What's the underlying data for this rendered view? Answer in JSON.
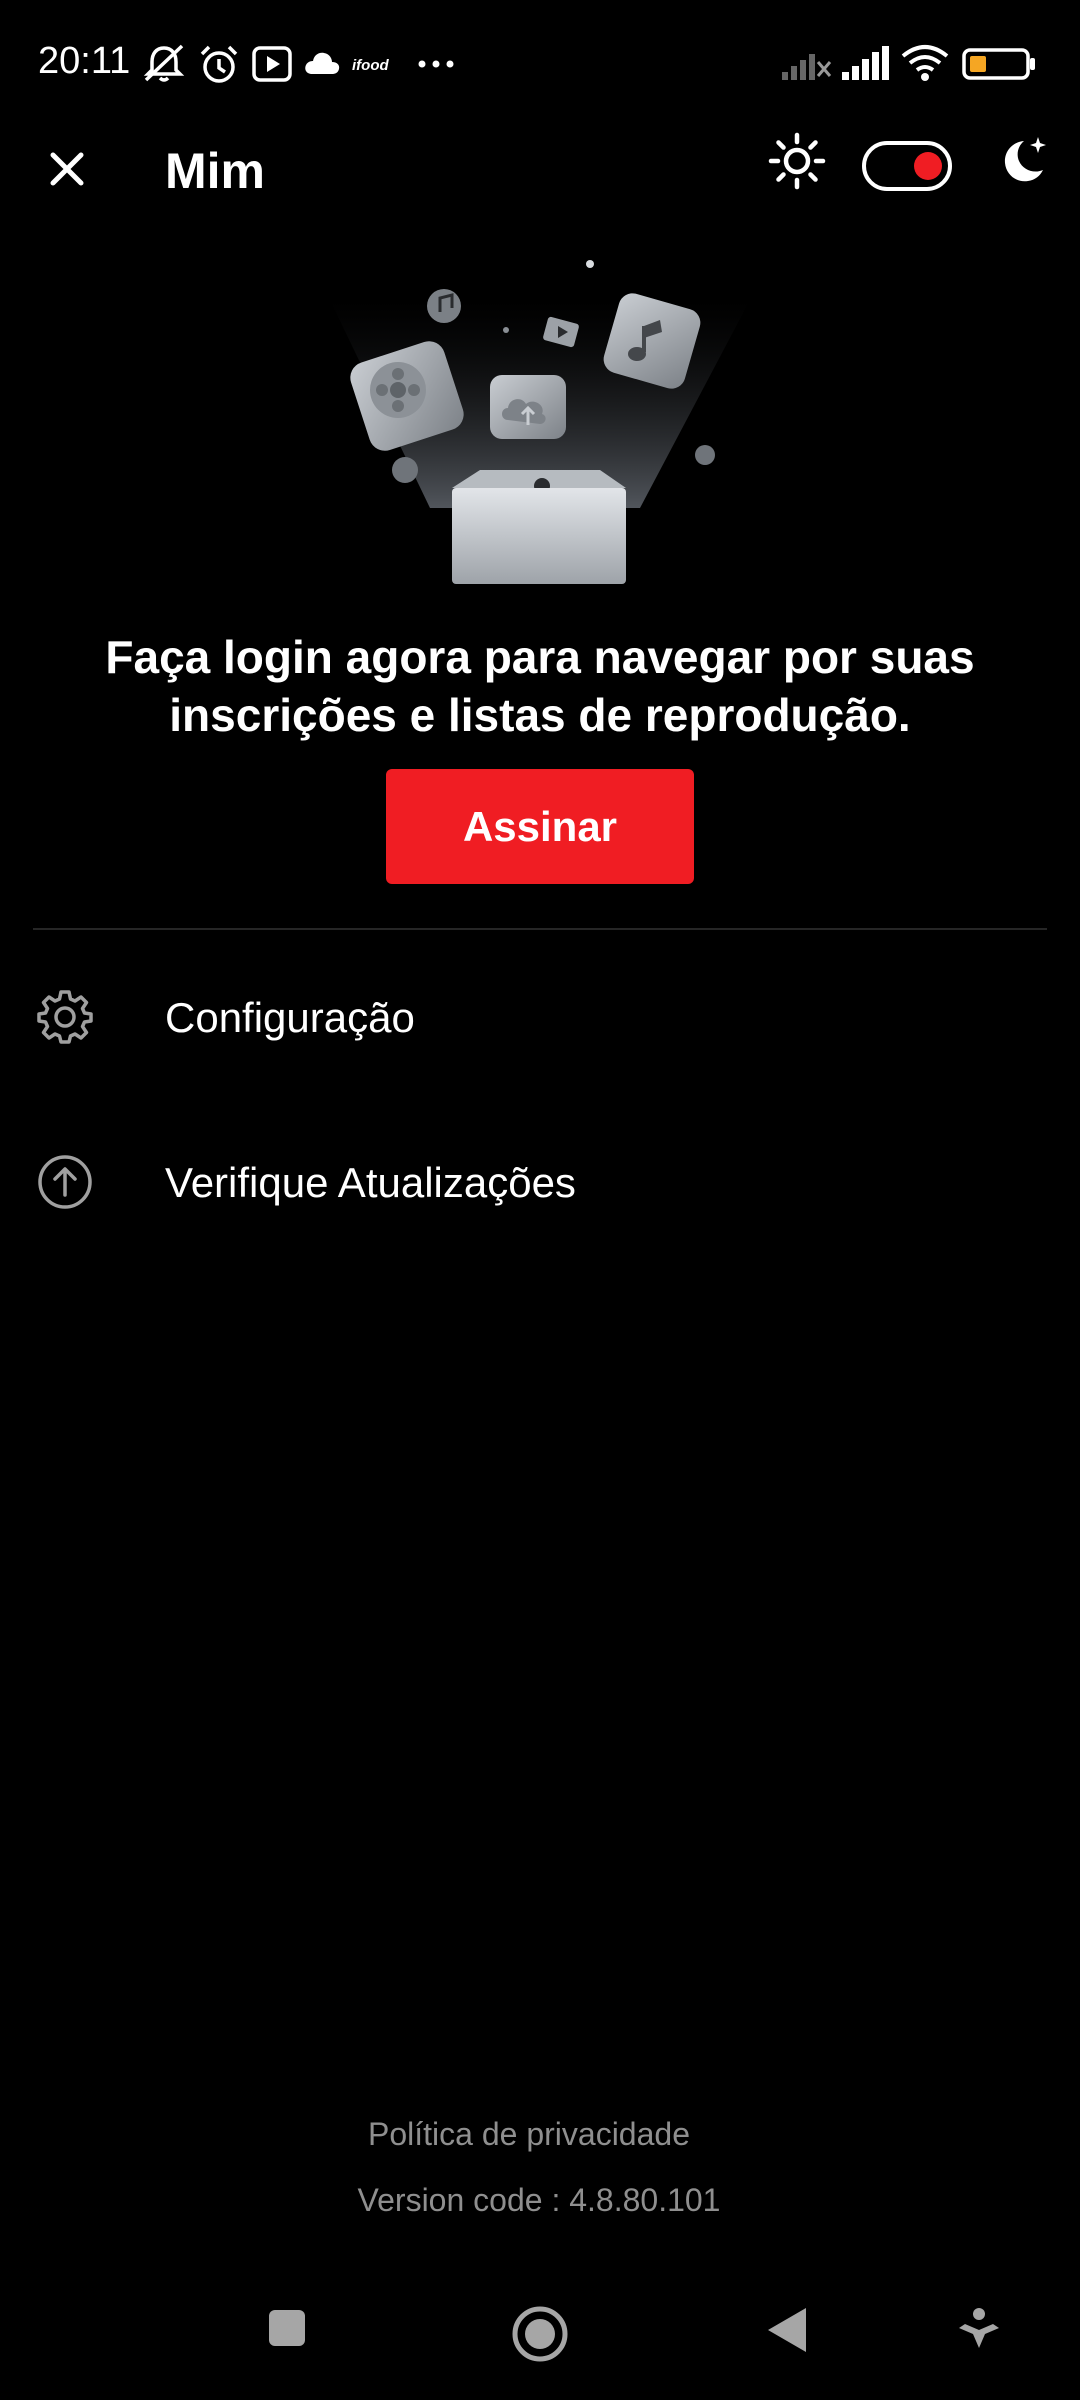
{
  "status_bar": {
    "time": "20:11",
    "icons": [
      "muted-icon",
      "alarm-icon",
      "youtube-icon",
      "cloud-icon",
      "ifood-icon",
      "more-dots-icon",
      "signal-no-sim-icon",
      "signal-icon",
      "wifi-icon",
      "battery-icon"
    ],
    "battery_color": "#f5a623"
  },
  "header": {
    "title": "Mim",
    "close_icon": "close-icon",
    "light_theme_icon": "sun-icon",
    "dark_theme_icon": "moon-icon",
    "toggle_accent": "#f01d23"
  },
  "hero": {
    "illustration": "media-box-illustration"
  },
  "login": {
    "message": "Faça login agora para navegar por suas inscrições e listas de reprodução.",
    "button_label": "Assinar",
    "button_color": "#f01d23"
  },
  "menu": {
    "items": [
      {
        "label": "Configuração",
        "icon": "gear-icon"
      },
      {
        "label": "Verifique Atualizações",
        "icon": "arrow-up-circle-icon"
      }
    ]
  },
  "footer": {
    "privacy_link": "Política de privacidade",
    "version": "Version code : 4.8.80.101"
  },
  "nav_bar": {
    "icons": [
      "recents-icon",
      "home-icon",
      "back-icon",
      "accessibility-icon"
    ]
  }
}
